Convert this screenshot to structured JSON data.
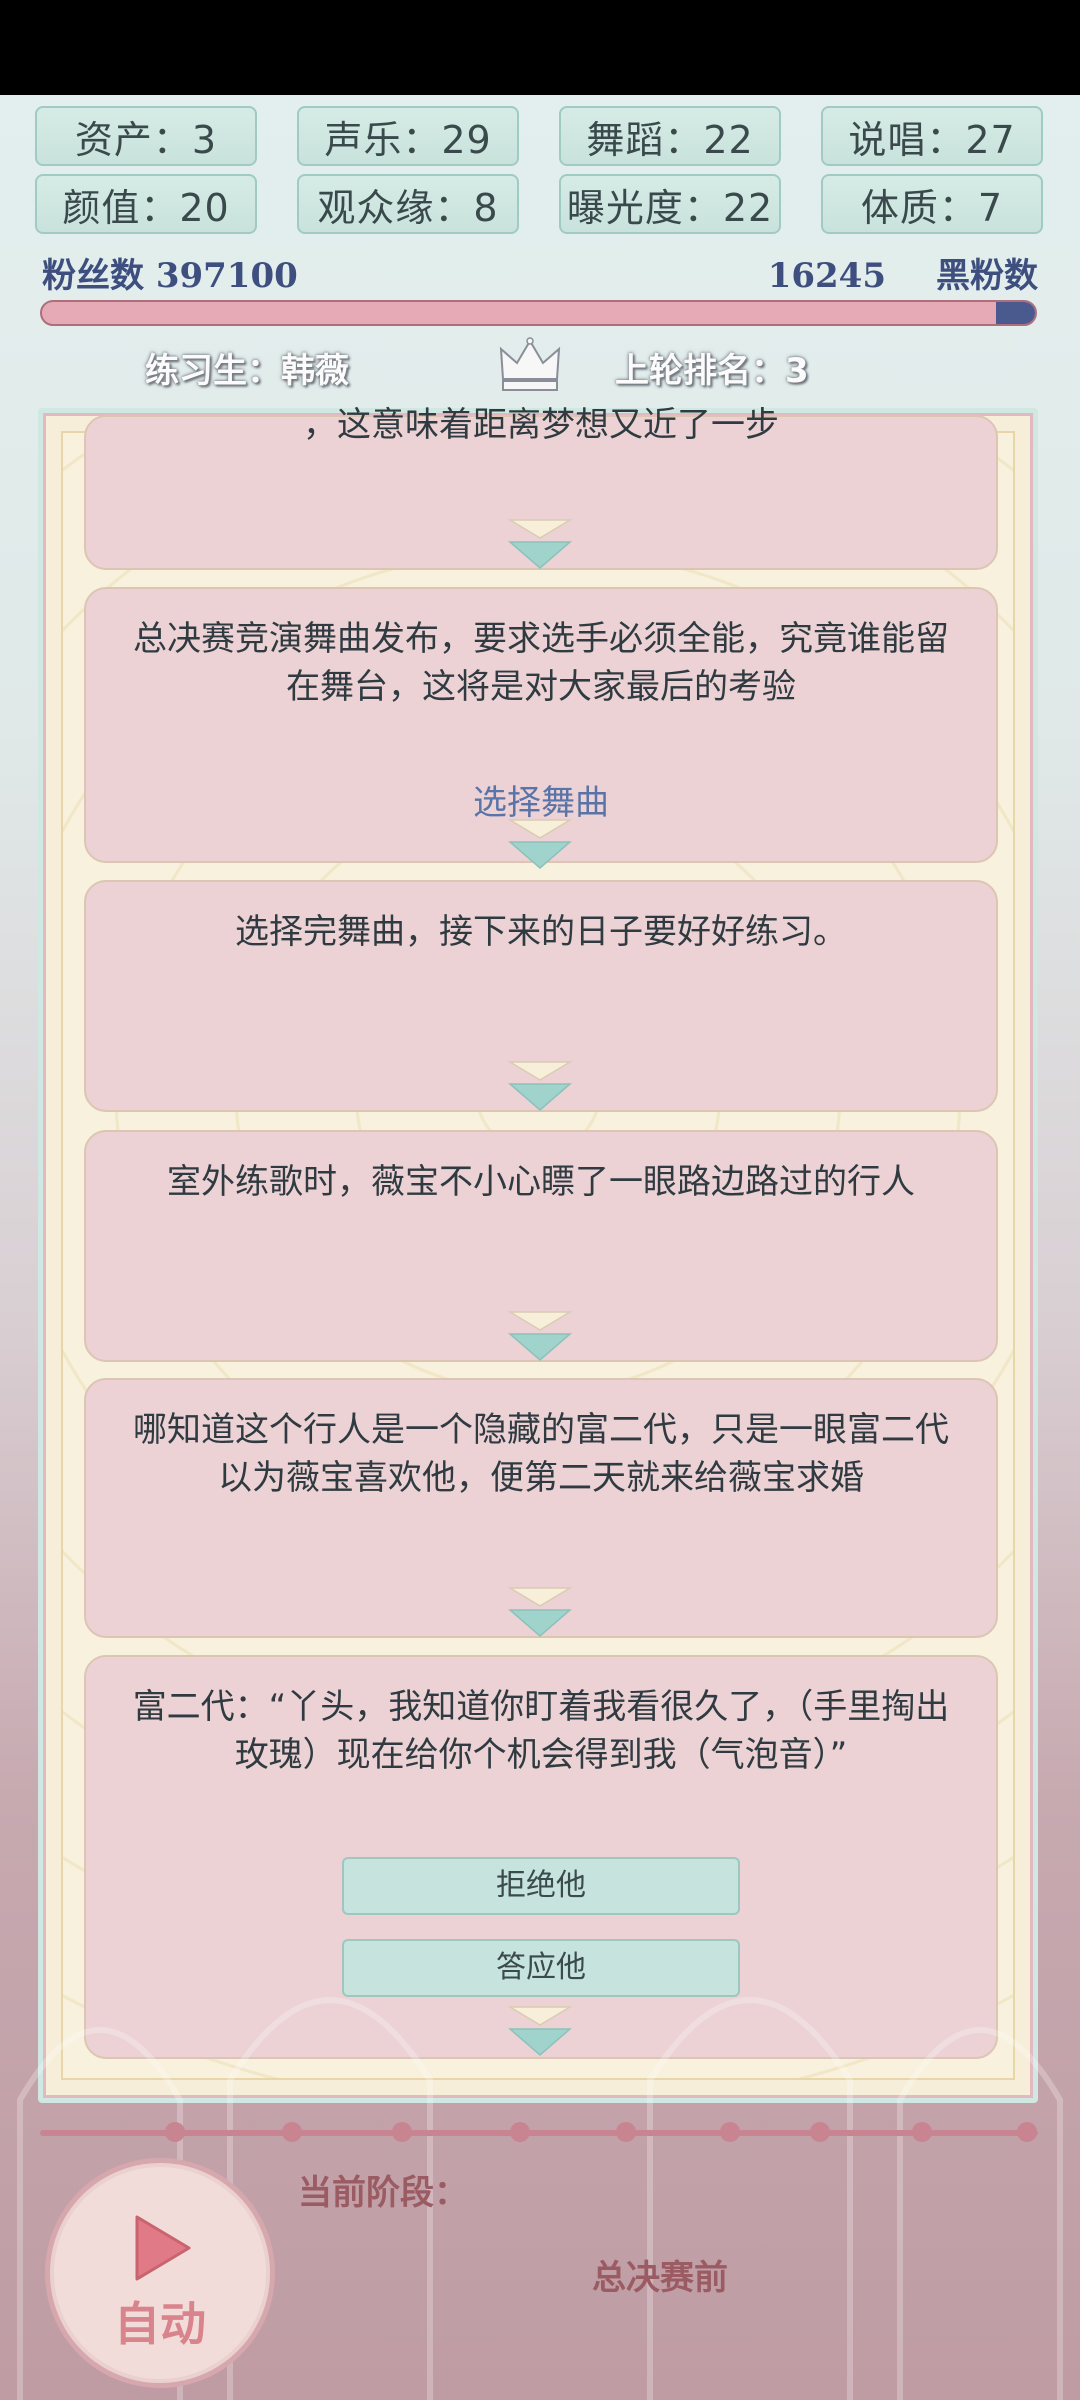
{
  "stats": [
    {
      "label": "资产",
      "value": "3"
    },
    {
      "label": "声乐",
      "value": "29"
    },
    {
      "label": "舞蹈",
      "value": "22"
    },
    {
      "label": "说唱",
      "value": "27"
    },
    {
      "label": "颜值",
      "value": "20"
    },
    {
      "label": "观众缘",
      "value": "8"
    },
    {
      "label": "曝光度",
      "value": "22"
    },
    {
      "label": "体质",
      "value": "7"
    }
  ],
  "stat_texts": [
    "资产：3",
    "声乐：29",
    "舞蹈：22",
    "说唱：27",
    "颜值：20",
    "观众缘：8",
    "曝光度：22",
    "体质：7"
  ],
  "fans": {
    "label": "粉丝数",
    "value": "397100",
    "fans_text": "粉丝数 397100"
  },
  "anti_fans": {
    "label": "黑粉数",
    "value": "16245"
  },
  "fan_ratio": 0.961,
  "trainee": {
    "text": "练习生：韩薇"
  },
  "rank": {
    "text": "上轮排名：3"
  },
  "story": {
    "partial_text": "，这意味着距离梦想又近了一步",
    "cards": [
      {
        "text": "总决赛竞演舞曲发布，要求选手必须全能，究竟谁能留在舞台，这将是对大家最后的考验",
        "link": "选择舞曲"
      },
      {
        "text": "选择完舞曲，接下来的日子要好好练习。"
      },
      {
        "text": "室外练歌时，薇宝不小心瞟了一眼路边路过的行人"
      },
      {
        "text": "哪知道这个行人是一个隐藏的富二代，只是一眼富二代以为薇宝喜欢他，便第二天就来给薇宝求婚"
      },
      {
        "text": "富二代：“丫头，我知道你盯着我看很久了，（手里掏出玫瑰）现在给你个机会得到我（气泡音）”",
        "choices": [
          "拒绝他",
          "答应他"
        ]
      }
    ]
  },
  "stage": {
    "label": "当前阶段：",
    "value": "总决赛前"
  },
  "auto_button": {
    "label": "自动"
  },
  "colors": {
    "accent_pink": "#e6a9b6",
    "navy": "#4a5a8e",
    "mint": "#c6e3dd",
    "card": "#ecd2d5"
  }
}
